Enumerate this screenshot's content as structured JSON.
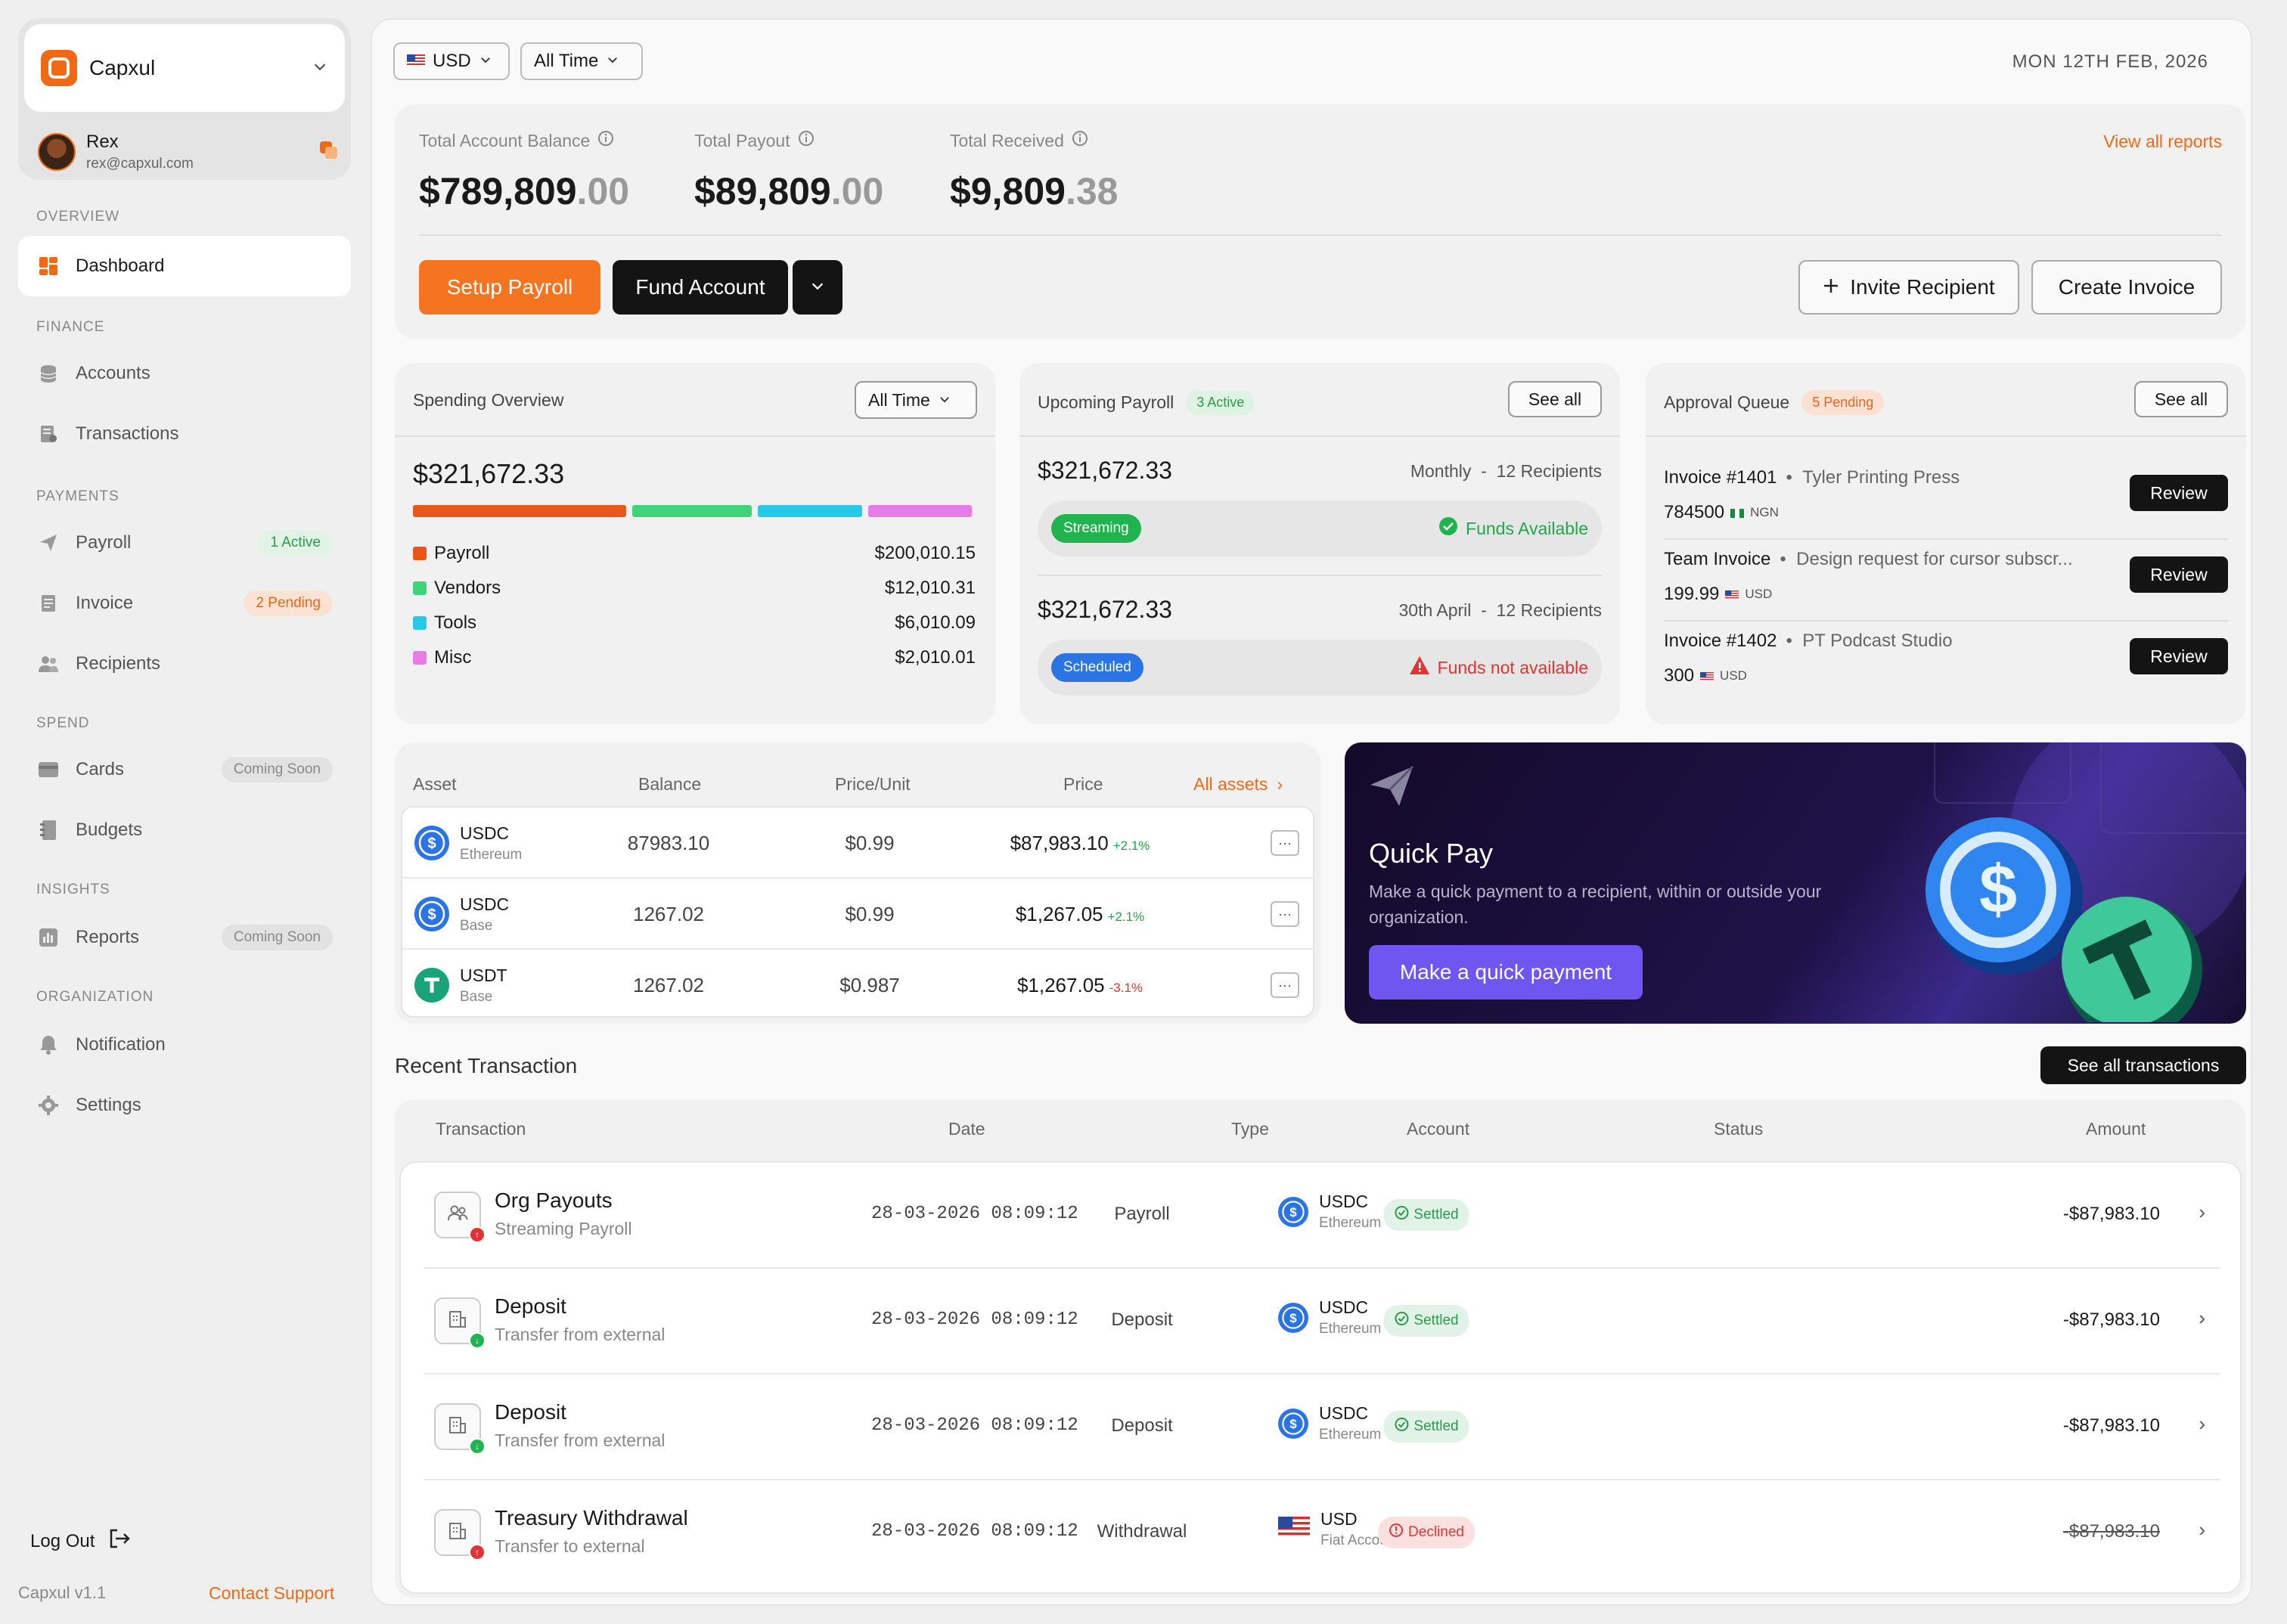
{
  "workspace": {
    "name": "Capxul",
    "user_name": "Rex",
    "user_email": "rex@capxul.com"
  },
  "sidebar": {
    "sections": [
      "OVERVIEW",
      "FINANCE",
      "PAYMENTS",
      "SPEND",
      "INSIGHTS",
      "ORGANIZATION"
    ],
    "items": [
      {
        "label": "Dashboard",
        "icon": "dashboard-icon"
      },
      {
        "label": "Accounts",
        "icon": "database-icon"
      },
      {
        "label": "Transactions",
        "icon": "receipt-icon"
      },
      {
        "label": "Payroll",
        "icon": "send-icon",
        "badge": "1 Active"
      },
      {
        "label": "Invoice",
        "icon": "document-icon",
        "badge": "2 Pending"
      },
      {
        "label": "Recipients",
        "icon": "users-icon"
      },
      {
        "label": "Cards",
        "icon": "card-icon",
        "badge": "Coming Soon"
      },
      {
        "label": "Budgets",
        "icon": "notebook-icon"
      },
      {
        "label": "Reports",
        "icon": "chart-icon",
        "badge": "Coming Soon"
      },
      {
        "label": "Notification",
        "icon": "bell-icon"
      },
      {
        "label": "Settings",
        "icon": "gear-icon"
      }
    ],
    "logout": "Log Out",
    "version": "Capxul v1.1",
    "support": "Contact Support"
  },
  "header": {
    "currency": "USD",
    "range": "All Time",
    "date": "MON 12TH FEB, 2026"
  },
  "summary": {
    "stats": [
      {
        "label": "Total Account Balance",
        "whole": "$789,809",
        "cents": ".00"
      },
      {
        "label": "Total Payout",
        "whole": "$89,809",
        "cents": ".00"
      },
      {
        "label": "Total Received",
        "whole": "$9,809",
        "cents": ".38"
      }
    ],
    "view_reports": "View all reports",
    "setup_payroll": "Setup Payroll",
    "fund_account": "Fund Account",
    "invite_recipient": "Invite Recipient",
    "create_invoice": "Create Invoice"
  },
  "spending": {
    "title": "Spending Overview",
    "range": "All Time",
    "total": "$321,672.33",
    "items": [
      {
        "label": "Payroll",
        "value": "$200,010.15",
        "color": "#e8561a",
        "bar": 0.39
      },
      {
        "label": "Vendors",
        "value": "$12,010.31",
        "color": "#3fd47a",
        "bar": 0.22
      },
      {
        "label": "Tools",
        "value": "$6,010.09",
        "color": "#27c8e8",
        "bar": 0.19
      },
      {
        "label": "Misc",
        "value": "$2,010.01",
        "color": "#e67ce6",
        "bar": 0.19
      }
    ]
  },
  "payroll": {
    "title": "Upcoming Payroll",
    "badge": "3 Active",
    "see_all": "See all",
    "items": [
      {
        "amount": "$321,672.33",
        "schedule": "Monthly",
        "recipients": "12 Recipients",
        "status": "Streaming",
        "funds": "Funds Available"
      },
      {
        "amount": "$321,672.33",
        "schedule": "30th April",
        "recipients": "12 Recipients",
        "status": "Scheduled",
        "funds": "Funds not available"
      }
    ]
  },
  "approval": {
    "title": "Approval Queue",
    "badge": "5 Pending",
    "see_all": "See all",
    "review": "Review",
    "items": [
      {
        "title": "Invoice #1401",
        "sub": "Tyler Printing Press",
        "amount": "784500",
        "currency": "NGN"
      },
      {
        "title": "Team Invoice",
        "sub": "Design request for cursor subscr...",
        "amount": "199.99",
        "currency": "USD"
      },
      {
        "title": "Invoice #1402",
        "sub": "PT Podcast Studio",
        "amount": "300",
        "currency": "USD"
      }
    ]
  },
  "assets": {
    "headers": [
      "Asset",
      "Balance",
      "Price/Unit",
      "Price"
    ],
    "all_assets": "All assets",
    "rows": [
      {
        "name": "USDC",
        "network": "Ethereum",
        "balance": "87983.10",
        "unit": "$0.99",
        "price": "$87,983.10",
        "change": "+2.1%",
        "up": true,
        "coin": "usdc"
      },
      {
        "name": "USDC",
        "network": "Base",
        "balance": "1267.02",
        "unit": "$0.99",
        "price": "$1,267.05",
        "change": "+2.1%",
        "up": true,
        "coin": "usdc"
      },
      {
        "name": "USDT",
        "network": "Base",
        "balance": "1267.02",
        "unit": "$0.987",
        "price": "$1,267.05",
        "change": "-3.1%",
        "up": false,
        "coin": "usdt"
      }
    ]
  },
  "quickpay": {
    "title": "Quick Pay",
    "desc": "Make a quick payment to a recipient, within or outside your organization.",
    "button": "Make a quick payment"
  },
  "transactions": {
    "title": "Recent Transaction",
    "see_all": "See all transactions",
    "headers": [
      "Transaction",
      "Date",
      "Type",
      "Account",
      "Status",
      "Amount"
    ],
    "rows": [
      {
        "name": "Org Payouts",
        "sub": "Streaming Payroll",
        "date": "28-03-2026 08:09:12",
        "type": "Payroll",
        "account": "USDC",
        "account_sub": "Ethereum",
        "status": "Settled",
        "amount": "-$87,983.10",
        "dir": "out"
      },
      {
        "name": "Deposit",
        "sub": "Transfer from external",
        "date": "28-03-2026 08:09:12",
        "type": "Deposit",
        "account": "USDC",
        "account_sub": "Ethereum",
        "status": "Settled",
        "amount": "-$87,983.10",
        "dir": "in"
      },
      {
        "name": "Deposit",
        "sub": "Transfer from external",
        "date": "28-03-2026 08:09:12",
        "type": "Deposit",
        "account": "USDC",
        "account_sub": "Ethereum",
        "status": "Settled",
        "amount": "-$87,983.10",
        "dir": "in"
      },
      {
        "name": "Treasury Withdrawal",
        "sub": "Transfer to external",
        "date": "28-03-2026 08:09:12",
        "type": "Withdrawal",
        "account": "USD",
        "account_sub": "Fiat Account",
        "status": "Declined",
        "amount": "-$87,983.10",
        "dir": "out"
      }
    ]
  }
}
